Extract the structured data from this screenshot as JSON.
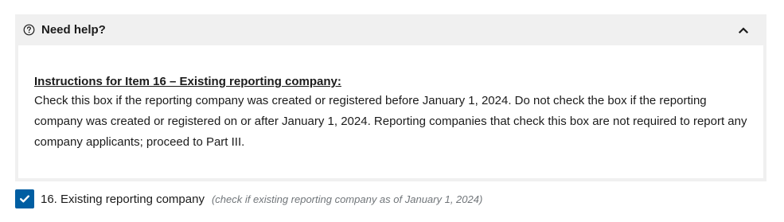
{
  "help": {
    "title": "Need help?",
    "heading": "Instructions for Item 16 – Existing reporting company:",
    "body": "Check this box if the reporting company was created or registered before January 1, 2024. Do not check the box if the reporting company was created or registered on or after January 1, 2024. Reporting companies that check this box are not required to report any company applicants; proceed to Part III.",
    "expanded": true,
    "icons": {
      "help": "question-circle-icon",
      "toggle": "chevron-up-icon"
    }
  },
  "item16": {
    "label": "16. Existing reporting company",
    "hint": "(check if existing reporting company as of January 1, 2024)",
    "checked": true,
    "check_icon": "checkmark-icon"
  },
  "colors": {
    "panel_background": "#f0f0f0",
    "checkbox_fill": "#005ea2",
    "hint_text": "#71767a",
    "body_text": "#1b1b1b"
  }
}
